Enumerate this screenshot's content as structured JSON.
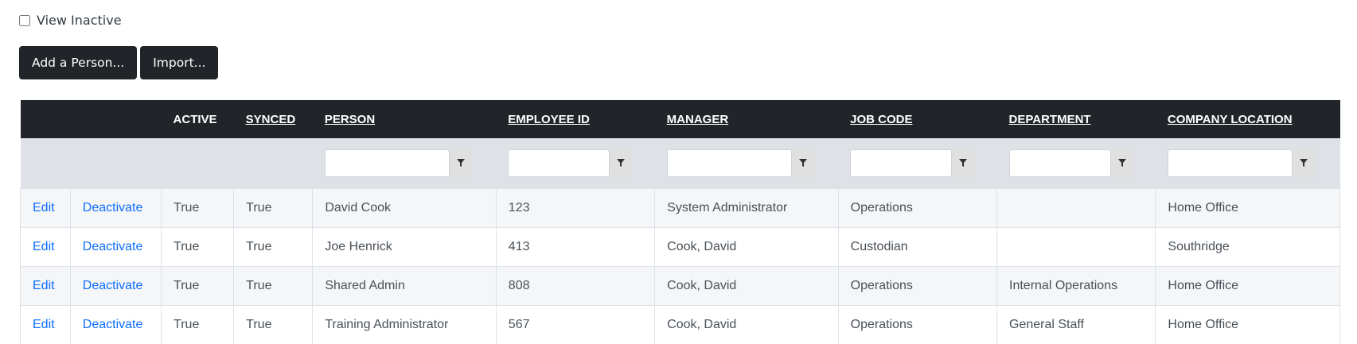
{
  "view_inactive": {
    "label": "View Inactive",
    "checked": false
  },
  "buttons": {
    "add": "Add a Person...",
    "import": "Import..."
  },
  "table": {
    "headers": [
      "",
      "",
      "ACTIVE",
      "SYNCED",
      "PERSON",
      "EMPLOYEE ID",
      "MANAGER",
      "JOB CODE",
      "DEPARTMENT",
      "COMPANY LOCATION"
    ],
    "filter_icon": "filter-funnel-icon",
    "rows": [
      {
        "edit": "Edit",
        "deactivate": "Deactivate",
        "active": "True",
        "synced": "True",
        "person": "David Cook",
        "employee_id": "123",
        "manager": "System Administrator",
        "job_code": "Operations",
        "department": "",
        "location": "Home Office"
      },
      {
        "edit": "Edit",
        "deactivate": "Deactivate",
        "active": "True",
        "synced": "True",
        "person": "Joe Henrick",
        "employee_id": "413",
        "manager": "Cook, David",
        "job_code": "Custodian",
        "department": "",
        "location": "Southridge"
      },
      {
        "edit": "Edit",
        "deactivate": "Deactivate",
        "active": "True",
        "synced": "True",
        "person": "Shared Admin",
        "employee_id": "808",
        "manager": "Cook, David",
        "job_code": "Operations",
        "department": "Internal Operations",
        "location": "Home Office"
      },
      {
        "edit": "Edit",
        "deactivate": "Deactivate",
        "active": "True",
        "synced": "True",
        "person": "Training Administrator",
        "employee_id": "567",
        "manager": "Cook, David",
        "job_code": "Operations",
        "department": "General Staff",
        "location": "Home Office"
      }
    ]
  }
}
